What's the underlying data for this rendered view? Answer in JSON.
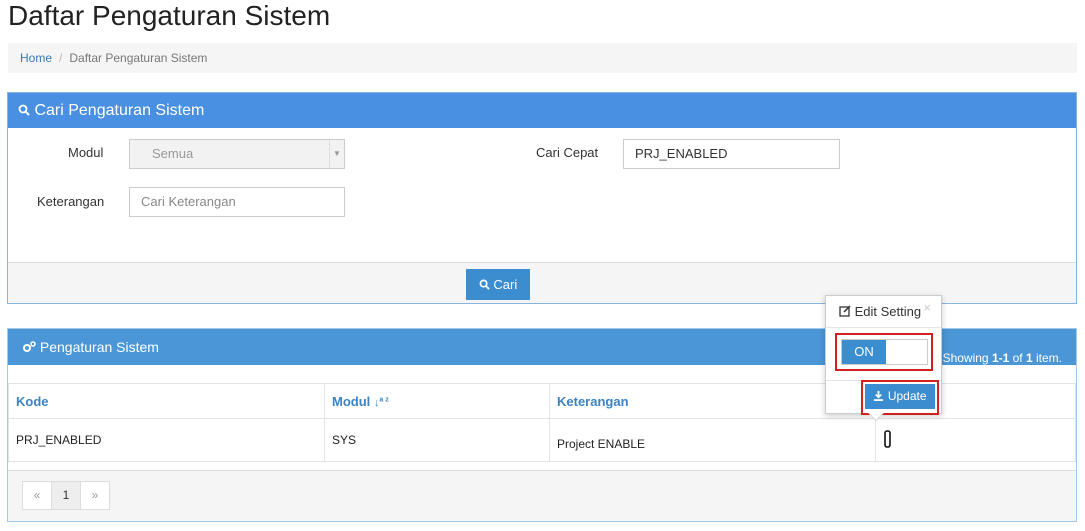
{
  "page": {
    "title": "Daftar Pengaturan Sistem"
  },
  "breadcrumb": {
    "home": "Home",
    "current": "Daftar Pengaturan Sistem"
  },
  "search_panel": {
    "title": "Cari Pengaturan Sistem",
    "modul_label": "Modul",
    "modul_value": "Semua",
    "cari_cepat_label": "Cari Cepat",
    "cari_cepat_value": "PRJ_ENABLED",
    "keterangan_label": "Keterangan",
    "keterangan_placeholder": "Cari Keterangan",
    "cari_button": "Cari"
  },
  "table_panel": {
    "title": "Pengaturan Sistem",
    "summary_prefix": "Showing ",
    "summary_range": "1-1",
    "summary_mid": " of ",
    "summary_total": "1",
    "summary_suffix": " item.",
    "columns": [
      "Kode",
      "Modul",
      "Keterangan"
    ],
    "rows": [
      {
        "kode": "PRJ_ENABLED",
        "modul": "SYS",
        "keterangan": "Project ENABLE"
      }
    ]
  },
  "pagination": {
    "prev": "«",
    "current": "1",
    "next": "»"
  },
  "popover": {
    "title": "Edit Setting",
    "close": "×",
    "toggle_state": "ON",
    "update_button": "Update"
  },
  "colors": {
    "primary": "#4a90e2",
    "button": "#3c8dd0",
    "highlight": "#d21f1f"
  },
  "icons": [
    "search-icon",
    "cogs-icon",
    "sort-icon",
    "edit-icon",
    "download-icon",
    "pencil-icon",
    "close-icon",
    "caret-down-icon"
  ]
}
